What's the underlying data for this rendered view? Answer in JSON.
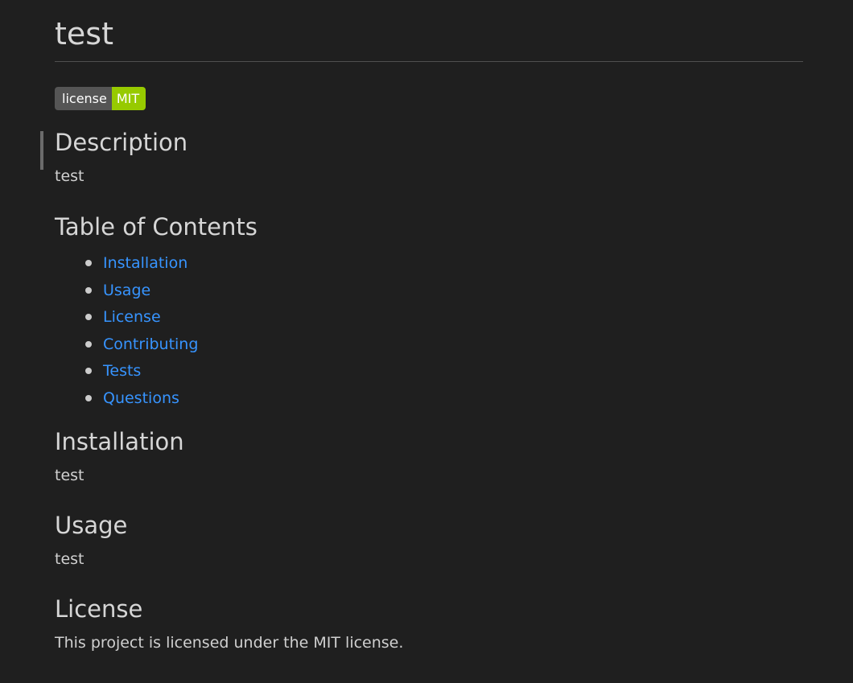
{
  "document": {
    "title": "test",
    "badge": {
      "label": "license",
      "value": "MIT",
      "label_color": "#555555",
      "value_color": "#97ca00"
    },
    "description": {
      "heading": "Description",
      "text": "test"
    },
    "toc": {
      "heading": "Table of Contents",
      "items": [
        "Installation",
        "Usage",
        "License",
        "Contributing",
        "Tests",
        "Questions"
      ]
    },
    "installation": {
      "heading": "Installation",
      "text": "test"
    },
    "usage": {
      "heading": "Usage",
      "text": "test"
    },
    "license": {
      "heading": "License",
      "text": "This project is licensed under the MIT license."
    }
  },
  "colors": {
    "background": "#1f1f1f",
    "link": "#3794ff",
    "text": "#cccccc"
  }
}
